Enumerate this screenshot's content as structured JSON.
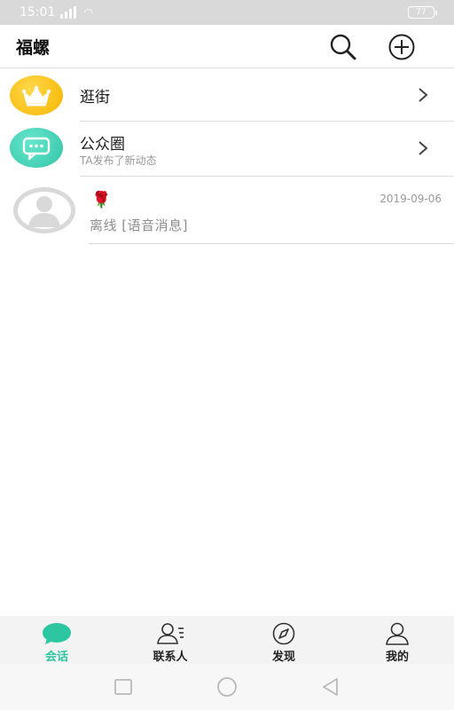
{
  "status_bar": {
    "time": "15:01",
    "battery": "77"
  },
  "header": {
    "title": "福螺"
  },
  "list": {
    "shopping": {
      "title": "逛街"
    },
    "public": {
      "title": "公众圈",
      "subtitle": "TA发布了新动态"
    },
    "chat": {
      "name_emoji": "🌹",
      "date": "2019-09-06",
      "preview": "离线 [语音消息]"
    }
  },
  "tabs": [
    {
      "label": "会话",
      "icon": "chat-bubble-icon",
      "active": true
    },
    {
      "label": "联系人",
      "icon": "contacts-icon",
      "active": false
    },
    {
      "label": "发现",
      "icon": "compass-icon",
      "active": false
    },
    {
      "label": "我的",
      "icon": "profile-icon",
      "active": false
    }
  ],
  "colors": {
    "accent": "#2cc6a0",
    "crown_bg": "#f7b500",
    "bubble_bg": "#33c4a8",
    "status_bar": "#d9d9d9"
  }
}
